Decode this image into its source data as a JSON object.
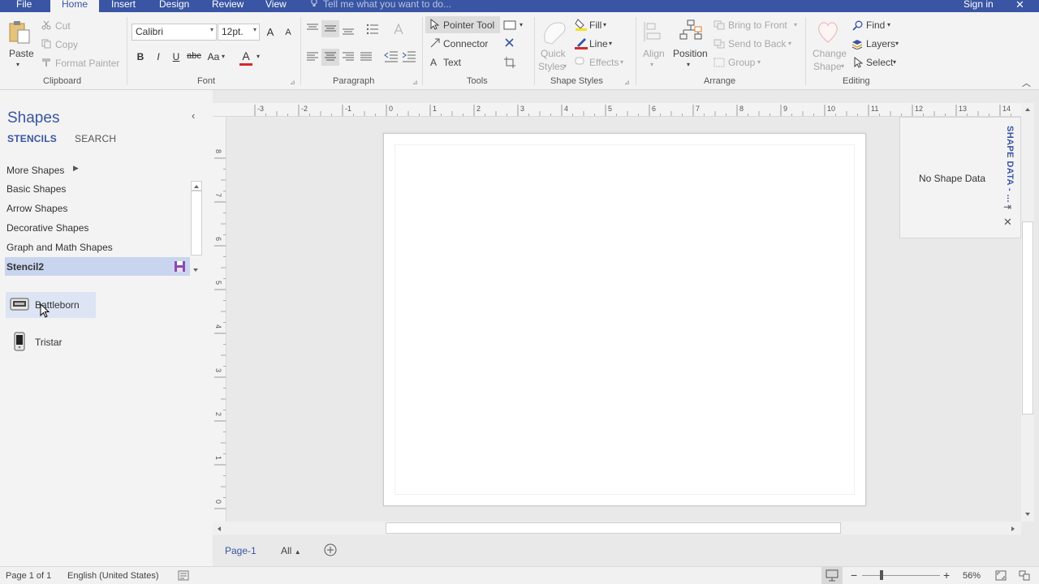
{
  "menu": {
    "file": "File",
    "tabs": [
      "Home",
      "Insert",
      "Design",
      "Review",
      "View"
    ],
    "tell_me": "Tell me what you want to do...",
    "sign_in": "Sign in",
    "close": "✕"
  },
  "ribbon": {
    "clipboard": {
      "paste": "Paste",
      "cut": "Cut",
      "copy": "Copy",
      "format_painter": "Format Painter",
      "label": "Clipboard"
    },
    "font": {
      "family": "Calibri",
      "size": "12pt.",
      "bold": "B",
      "italic": "I",
      "underline": "U",
      "strike": "abc",
      "case": "Aa",
      "grow": "A",
      "shrink": "A",
      "color": "A",
      "label": "Font"
    },
    "paragraph": {
      "label": "Paragraph"
    },
    "tools": {
      "pointer": "Pointer Tool",
      "connector": "Connector",
      "text": "Text",
      "label": "Tools"
    },
    "shape_styles": {
      "quick_styles_1": "Quick",
      "quick_styles_2": "Styles",
      "fill": "Fill",
      "line": "Line",
      "effects": "Effects",
      "label": "Shape Styles"
    },
    "arrange": {
      "align": "Align",
      "position": "Position",
      "bring_front": "Bring to Front",
      "send_back": "Send to Back",
      "group": "Group",
      "label": "Arrange"
    },
    "editing": {
      "change_shape_1": "Change",
      "change_shape_2": "Shape",
      "find": "Find",
      "layers": "Layers",
      "select": "Select",
      "label": "Editing"
    }
  },
  "shapes_panel": {
    "title": "Shapes",
    "tab_stencils": "STENCILS",
    "tab_search": "SEARCH",
    "more_shapes": "More Shapes",
    "stencils": [
      "Basic Shapes",
      "Arrow Shapes",
      "Decorative Shapes",
      "Graph and Math Shapes"
    ],
    "active_stencil": "Stencil2",
    "masters": [
      "Battleborn",
      "Tristar"
    ]
  },
  "ruler": {
    "h_labels": [
      "-3",
      "-2",
      "-1",
      "0",
      "1",
      "2",
      "3",
      "4",
      "5",
      "6",
      "7",
      "8",
      "9",
      "10",
      "11",
      "12",
      "13",
      "14"
    ],
    "v_labels": [
      "8",
      "7",
      "6",
      "5",
      "4",
      "3",
      "2",
      "1",
      "0"
    ]
  },
  "shape_data": {
    "title": "SHAPE DATA - ...",
    "empty": "No Shape Data"
  },
  "page_tabs": {
    "page1": "Page-1",
    "all": "All"
  },
  "status": {
    "page": "Page 1 of 1",
    "language": "English (United States)",
    "zoom": "56%"
  },
  "colors": {
    "accent": "#3955a3",
    "selection": "#c9d5ef",
    "font_color_bar": "#d62a2a",
    "line_color_bar": "#d62a2a",
    "fill_color_bar": "#f4e11d"
  }
}
